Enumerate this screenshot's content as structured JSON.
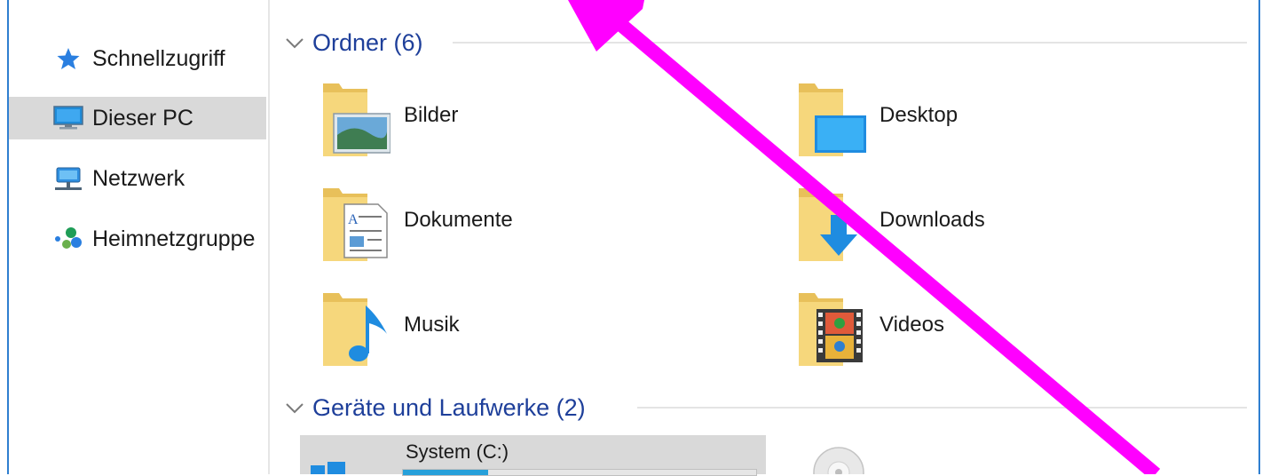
{
  "sidebar": {
    "items": [
      {
        "label": "Schnellzugriff",
        "icon": "star-icon"
      },
      {
        "label": "Dieser PC",
        "icon": "computer-icon",
        "selected": true
      },
      {
        "label": "Netzwerk",
        "icon": "network-icon"
      },
      {
        "label": "Heimnetzgruppe",
        "icon": "homegroup-icon"
      }
    ]
  },
  "folders_section": {
    "title": "Ordner (6)",
    "items": [
      {
        "label": "Bilder",
        "icon": "pictures-folder-icon"
      },
      {
        "label": "Desktop",
        "icon": "desktop-folder-icon"
      },
      {
        "label": "Dokumente",
        "icon": "documents-folder-icon"
      },
      {
        "label": "Downloads",
        "icon": "downloads-folder-icon"
      },
      {
        "label": "Musik",
        "icon": "music-folder-icon"
      },
      {
        "label": "Videos",
        "icon": "videos-folder-icon"
      }
    ]
  },
  "drives_section": {
    "title": "Geräte und Laufwerke (2)",
    "items": [
      {
        "label": "System (C:)",
        "icon": "windows-drive-icon",
        "used_fraction": 0.24
      },
      {
        "label": "",
        "icon": "dvd-drive-icon"
      }
    ]
  },
  "annotation": {
    "icon": "arrow-annotation",
    "color": "#ff00ff"
  },
  "colors": {
    "accent": "#1e3f9a",
    "border": "#2f7fd0",
    "selection": "#d9d9d9",
    "annotation": "#ff00ff"
  }
}
